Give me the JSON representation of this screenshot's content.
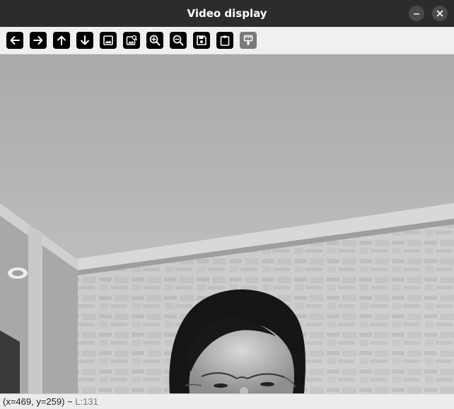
{
  "window": {
    "title": "Video display",
    "minimize_icon": "minimize-icon",
    "close_icon": "close-icon"
  },
  "toolbar": {
    "buttons": [
      {
        "name": "pan-left-button",
        "icon": "arrow-left-icon",
        "enabled": true
      },
      {
        "name": "pan-right-button",
        "icon": "arrow-right-icon",
        "enabled": true
      },
      {
        "name": "pan-up-button",
        "icon": "arrow-up-icon",
        "enabled": true
      },
      {
        "name": "pan-down-button",
        "icon": "arrow-down-icon",
        "enabled": true
      },
      {
        "name": "zoom-original-button",
        "icon": "image-icon",
        "enabled": true
      },
      {
        "name": "zoom-fit-button",
        "icon": "image-zoom-icon",
        "enabled": true
      },
      {
        "name": "zoom-in-button",
        "icon": "zoom-in-icon",
        "enabled": true
      },
      {
        "name": "zoom-out-button",
        "icon": "zoom-out-icon",
        "enabled": true
      },
      {
        "name": "save-image-button",
        "icon": "save-icon",
        "enabled": true
      },
      {
        "name": "copy-clipboard-button",
        "icon": "clipboard-icon",
        "enabled": true
      },
      {
        "name": "properties-button",
        "icon": "paint-brush-icon",
        "enabled": false
      }
    ]
  },
  "video": {
    "content": "webcam-frame-grayscale"
  },
  "status": {
    "coords": "(x=469, y=259) ~ ",
    "level": "L:131"
  },
  "colors": {
    "titlebar_bg": "#2c2c2c",
    "toolbar_bg": "#f0f0f0",
    "tool_icon_bg": "#000000",
    "tool_disabled_bg": "#7a7a7a",
    "status_level_text": "#7a7a7a"
  }
}
